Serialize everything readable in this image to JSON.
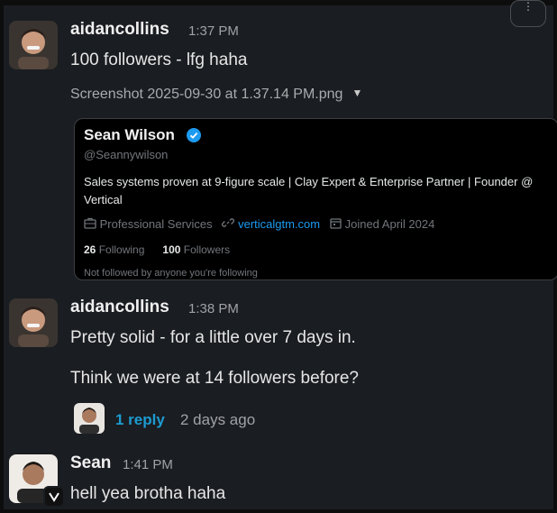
{
  "messages": [
    {
      "author": "aidancollins",
      "time": "1:37 PM",
      "text": "100 followers - lfg haha",
      "attachment": {
        "filename": "Screenshot 2025-09-30 at 1.37.14 PM.png",
        "profile": {
          "name": "Sean Wilson",
          "handle": "@Seannywilson",
          "bio": "Sales systems proven at 9-figure scale | Clay Expert & Enterprise Partner | Founder @ Vertical",
          "category": "Professional Services",
          "website": "verticalgtm.com",
          "joined": "Joined April 2024",
          "following_count": "26",
          "following_label": "Following",
          "followers_count": "100",
          "followers_label": "Followers",
          "note": "Not followed by anyone you're following"
        }
      }
    },
    {
      "author": "aidancollins",
      "time": "1:38 PM",
      "text": "Pretty solid - for a little over 7 days in.",
      "text2": "Think we were at 14 followers before?",
      "thread": {
        "reply_label": "1 reply",
        "reply_time": "2 days ago"
      }
    },
    {
      "author": "Sean",
      "time": "1:41 PM",
      "text": "hell yea brotha haha"
    }
  ],
  "colors": {
    "background": "#1a1d21",
    "link": "#1d9bd1",
    "verified": "#1d9bf0"
  },
  "icons": [
    "verified-badge-icon",
    "briefcase-icon",
    "link-icon",
    "calendar-icon",
    "caret-down-icon",
    "status-icon"
  ]
}
